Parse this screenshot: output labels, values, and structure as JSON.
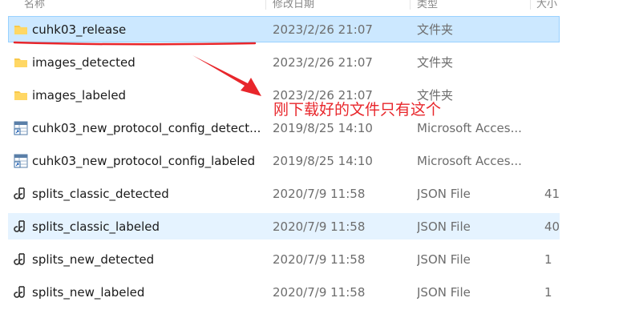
{
  "header": {
    "columns": [
      {
        "label": "名称"
      },
      {
        "label": "修改日期"
      },
      {
        "label": "类型"
      },
      {
        "label": "大小"
      }
    ]
  },
  "files": [
    {
      "name": "cuhk03_release",
      "date": "2023/2/26 21:07",
      "type": "文件夹",
      "size": "",
      "icon": "folder-icon",
      "state": "selected"
    },
    {
      "name": "images_detected",
      "date": "2023/2/26 21:07",
      "type": "文件夹",
      "size": "",
      "icon": "folder-icon",
      "state": ""
    },
    {
      "name": "images_labeled",
      "date": "2023/2/26 21:07",
      "type": "文件夹",
      "size": "",
      "icon": "folder-icon",
      "state": ""
    },
    {
      "name": "cuhk03_new_protocol_config_detect...",
      "date": "2019/8/25 14:10",
      "type": "Microsoft Acces...",
      "size": "",
      "icon": "shortcut-table-icon",
      "state": ""
    },
    {
      "name": "cuhk03_new_protocol_config_labeled",
      "date": "2019/8/25 14:10",
      "type": "Microsoft Acces...",
      "size": "",
      "icon": "shortcut-table-icon",
      "state": ""
    },
    {
      "name": "splits_classic_detected",
      "date": "2020/7/9 11:58",
      "type": "JSON File",
      "size": "41",
      "icon": "json-file-icon",
      "state": ""
    },
    {
      "name": "splits_classic_labeled",
      "date": "2020/7/9 11:58",
      "type": "JSON File",
      "size": "40",
      "icon": "json-file-icon",
      "state": "hovered"
    },
    {
      "name": "splits_new_detected",
      "date": "2020/7/9 11:58",
      "type": "JSON File",
      "size": "1",
      "icon": "json-file-icon",
      "state": ""
    },
    {
      "name": "splits_new_labeled",
      "date": "2020/7/9 11:58",
      "type": "JSON File",
      "size": "1",
      "icon": "json-file-icon",
      "state": ""
    }
  ],
  "annotation": {
    "text": "刚下载好的文件只有这个",
    "color": "#e8262b"
  },
  "colors": {
    "selected_bg": "#cce8ff",
    "selected_border": "#99d1ff",
    "hover_bg": "#e5f3ff",
    "folder": "#f8c84a"
  }
}
